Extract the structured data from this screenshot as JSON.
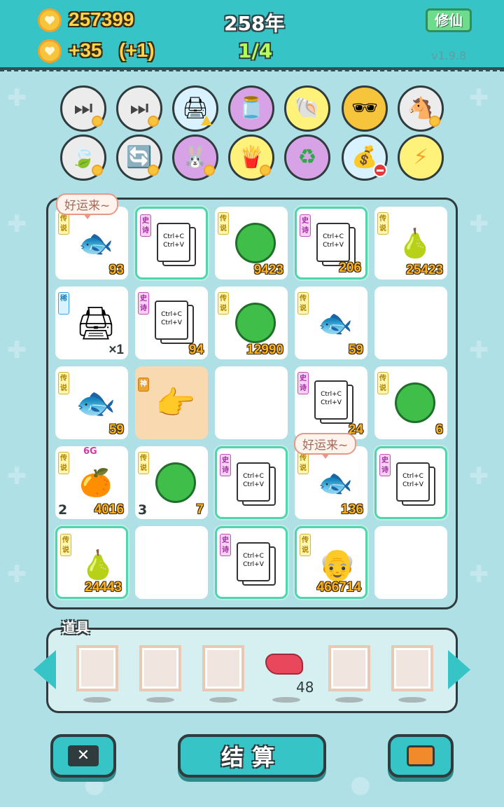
{
  "hud": {
    "coins": "257399",
    "income": "+35",
    "income_bonus": "(+1)",
    "year": "258年",
    "progress": "1/4",
    "mode_button": "修仙",
    "version": "v1.9.8"
  },
  "shop": {
    "row1": [
      "skip-icon",
      "skip-icon",
      "printer-icon",
      "jar-icon",
      "shell-icon",
      "sunglasses-icon",
      "horses-icon"
    ],
    "row2": [
      "leaf-icon",
      "refresh-icon",
      "rabbit-icon",
      "fries-icon",
      "recycle-icon",
      "sack-icon",
      "lightning-icon"
    ]
  },
  "board": {
    "bubble_1": "好运来~",
    "bubble_2": "好运来~",
    "tags": {
      "legend": "传说",
      "epic": "史诗",
      "mythic": "神"
    },
    "copy_text_1": "Ctrl+C",
    "copy_text_2": "Ctrl+V",
    "cells": [
      {
        "item": "koi-fish",
        "tag": "传说",
        "num": "93"
      },
      {
        "item": "copy-card",
        "tag": "史诗",
        "num": ""
      },
      {
        "item": "watermelon",
        "tag": "传说",
        "num": "9423"
      },
      {
        "item": "copy-card",
        "tag": "史诗",
        "num": "206"
      },
      {
        "item": "pear",
        "tag": "传说",
        "num": "25423"
      },
      {
        "item": "printer",
        "tag": "稀",
        "num": "×1"
      },
      {
        "item": "copy-card",
        "tag": "史诗",
        "num": "94"
      },
      {
        "item": "watermelon",
        "tag": "传说",
        "num": "12990"
      },
      {
        "item": "koi-fish",
        "tag": "传说",
        "num": "59"
      },
      {
        "item": "empty",
        "tag": "",
        "num": ""
      },
      {
        "item": "koi-fish",
        "tag": "传说",
        "num": "59"
      },
      {
        "item": "pointer-hand",
        "tag": "神",
        "num": ""
      },
      {
        "item": "empty",
        "tag": "",
        "num": ""
      },
      {
        "item": "copy-card",
        "tag": "史诗",
        "num": "24"
      },
      {
        "item": "watermelon",
        "tag": "传说",
        "num": "6"
      },
      {
        "item": "crowned-fruit",
        "tag": "传说",
        "num": "4016",
        "sub": "2",
        "badge": "6G"
      },
      {
        "item": "watermelon",
        "tag": "传说",
        "num": "7",
        "sub": "3"
      },
      {
        "item": "copy-card",
        "tag": "史诗",
        "num": ""
      },
      {
        "item": "koi-fish",
        "tag": "传说",
        "num": "136"
      },
      {
        "item": "copy-card",
        "tag": "史诗",
        "num": ""
      },
      {
        "item": "pear",
        "tag": "传说",
        "num": "24443"
      },
      {
        "item": "empty",
        "tag": "",
        "num": ""
      },
      {
        "item": "copy-card",
        "tag": "史诗",
        "num": ""
      },
      {
        "item": "old-man",
        "tag": "传说",
        "num": "466714"
      },
      {
        "item": "empty",
        "tag": "",
        "num": ""
      }
    ]
  },
  "items": {
    "label": "道具",
    "liver_count": "48"
  },
  "buttons": {
    "settle": "结算"
  },
  "colors": {
    "accent": "#37c4c6",
    "background": "#aee0e6",
    "gold": "#ffb21a",
    "legend": "#fff6b0",
    "epic": "#f7d0f3"
  }
}
